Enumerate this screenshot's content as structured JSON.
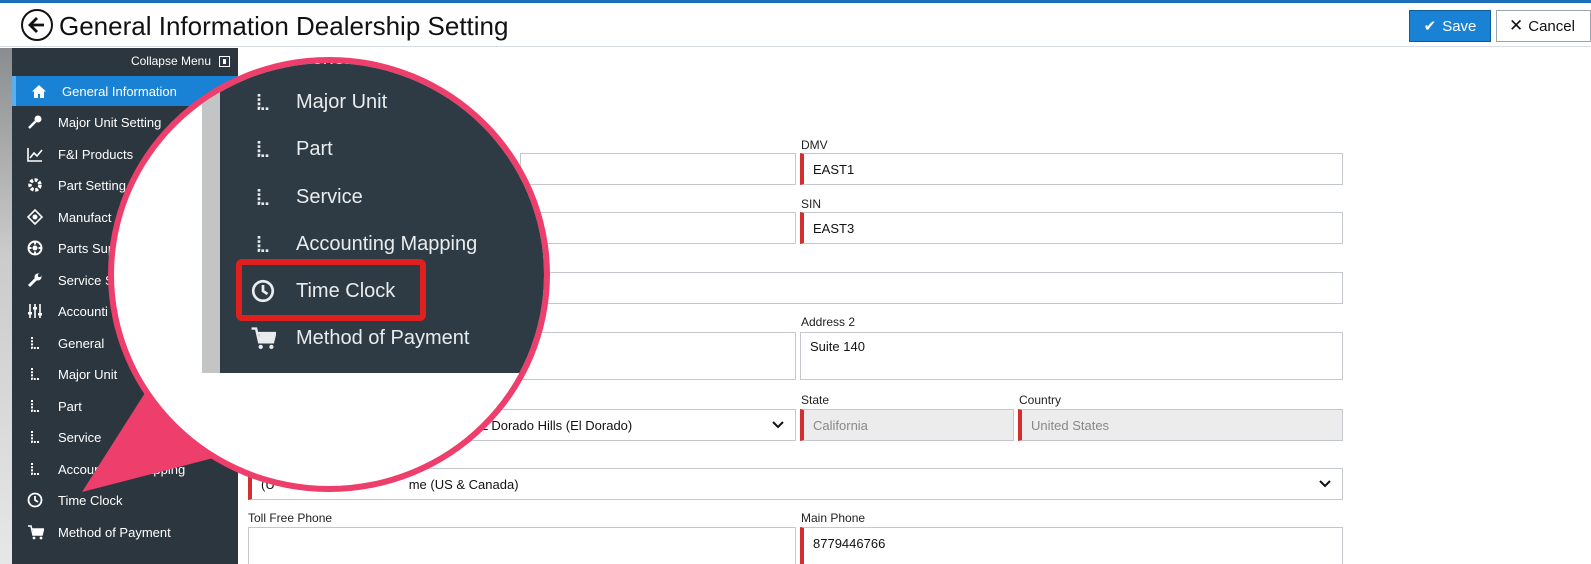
{
  "header": {
    "title": "General Information Dealership Setting",
    "save_label": "Save",
    "cancel_label": "Cancel"
  },
  "sidebar": {
    "collapse_label": "Collapse Menu",
    "items": [
      {
        "label": "General Information",
        "icon": "home-icon",
        "active": true
      },
      {
        "label": "Major Unit Setting",
        "icon": "key-icon"
      },
      {
        "label": "F&I Products",
        "icon": "chart-icon"
      },
      {
        "label": "Part Setting",
        "icon": "gear-icon"
      },
      {
        "label": "Manufact",
        "icon": "target-icon"
      },
      {
        "label": "Parts Sup",
        "icon": "globe-icon"
      },
      {
        "label": "Service S",
        "icon": "wrench-icon"
      },
      {
        "label": "Accounti",
        "icon": "sliders-icon"
      },
      {
        "label": "General",
        "icon": "l-icon"
      },
      {
        "label": "Major Unit",
        "icon": "l-icon"
      },
      {
        "label": "Part",
        "icon": "l-icon"
      },
      {
        "label": "Service",
        "icon": "l-icon"
      },
      {
        "label": "Accoun",
        "label2": "Mapping",
        "icon": "l-icon"
      },
      {
        "label": "Time Clock",
        "icon": "clock-icon"
      },
      {
        "label": "Method of Payment",
        "icon": "cart-icon"
      }
    ]
  },
  "magnifier": {
    "partial_top_label": "General",
    "items": [
      {
        "label": "Major Unit",
        "icon": "l-icon"
      },
      {
        "label": "Part",
        "icon": "l-icon"
      },
      {
        "label": "Service",
        "icon": "l-icon"
      },
      {
        "label": "Accounting Mapping",
        "icon": "l-icon"
      },
      {
        "label": "Time Clock",
        "icon": "clock-icon",
        "highlighted": true
      },
      {
        "label": "Method of Payment",
        "icon": "cart-icon"
      }
    ]
  },
  "form": {
    "dmv": {
      "label": "DMV",
      "value": "EAST1"
    },
    "sin": {
      "label": "SIN",
      "value": "EAST3"
    },
    "address2": {
      "label": "Address 2",
      "value": "Suite 140"
    },
    "city": {
      "value": "L Dorado Hills (El Dorado)"
    },
    "state": {
      "label": "State",
      "value": "California"
    },
    "country": {
      "label": "Country",
      "value": "United States"
    },
    "timezone": {
      "value_start": "(U",
      "value_end": "me (US & Canada)"
    },
    "toll_free_phone": {
      "label": "Toll Free Phone",
      "value": ""
    },
    "main_phone": {
      "label": "Main Phone",
      "value": "8779446766"
    }
  },
  "colors": {
    "accent": "#1a82d4",
    "sidebar_bg": "#2b363f",
    "required": "#d32f2f",
    "callout": "#ee3f6c",
    "highlight": "#e0201f"
  }
}
